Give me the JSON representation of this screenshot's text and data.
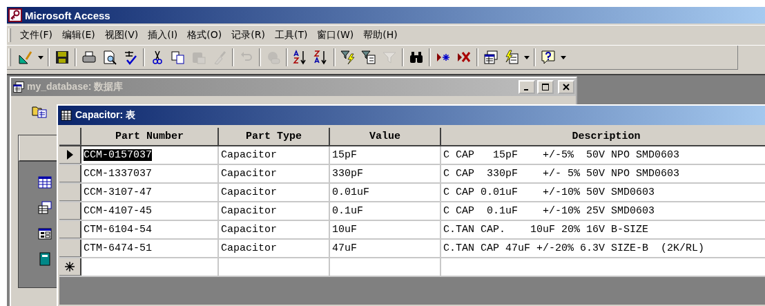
{
  "window": {
    "title": "Microsoft Access"
  },
  "menu": [
    "文件(F)",
    "编辑(E)",
    "视图(V)",
    "插入(I)",
    "格式(O)",
    "记录(R)",
    "工具(T)",
    "窗口(W)",
    "帮助(H)"
  ],
  "toolbar": [
    {
      "kind": "design",
      "disabled": false
    },
    {
      "kind": "caret",
      "disabled": false
    },
    {
      "kind": "separator"
    },
    {
      "kind": "save",
      "disabled": false
    },
    {
      "kind": "separator"
    },
    {
      "kind": "print",
      "disabled": false
    },
    {
      "kind": "preview",
      "disabled": false
    },
    {
      "kind": "spelling",
      "disabled": false
    },
    {
      "kind": "separator"
    },
    {
      "kind": "cut",
      "disabled": false
    },
    {
      "kind": "copy",
      "disabled": false
    },
    {
      "kind": "paste",
      "disabled": true
    },
    {
      "kind": "brush",
      "disabled": true
    },
    {
      "kind": "separator"
    },
    {
      "kind": "undo",
      "disabled": true
    },
    {
      "kind": "separator"
    },
    {
      "kind": "links",
      "disabled": true
    },
    {
      "kind": "separator"
    },
    {
      "kind": "sort_asc",
      "disabled": false
    },
    {
      "kind": "sort_desc",
      "disabled": false
    },
    {
      "kind": "separator"
    },
    {
      "kind": "filter_selection",
      "disabled": false
    },
    {
      "kind": "filter_form",
      "disabled": false
    },
    {
      "kind": "filter",
      "disabled": true
    },
    {
      "kind": "separator"
    },
    {
      "kind": "find",
      "disabled": false
    },
    {
      "kind": "separator"
    },
    {
      "kind": "new_record",
      "disabled": false
    },
    {
      "kind": "delete_record",
      "disabled": false
    },
    {
      "kind": "separator"
    },
    {
      "kind": "db_window",
      "disabled": false
    },
    {
      "kind": "new_object",
      "disabled": false
    },
    {
      "kind": "caret",
      "disabled": false
    },
    {
      "kind": "separator"
    },
    {
      "kind": "help",
      "disabled": false
    },
    {
      "kind": "caret",
      "disabled": false
    }
  ],
  "database_window": {
    "title": "my_database: 数据库",
    "active": false
  },
  "table_window": {
    "title": "Capacitor: 表",
    "active": true,
    "columns": [
      "Part Number",
      "Part Type",
      "Value",
      "Description"
    ],
    "rows": [
      {
        "current": true,
        "selected": true,
        "cells": [
          "CCM-0157037",
          "Capacitor",
          "15pF",
          "C CAP   15pF    +/-5%  50V NPO SMD0603"
        ]
      },
      {
        "current": false,
        "selected": false,
        "cells": [
          "CCM-1337037",
          "Capacitor",
          "330pF",
          "C CAP  330pF    +/- 5% 50V NPO SMD0603"
        ]
      },
      {
        "current": false,
        "selected": false,
        "cells": [
          "CCM-3107-47",
          "Capacitor",
          "0.01uF",
          "C CAP 0.01uF    +/-10% 50V SMD0603"
        ]
      },
      {
        "current": false,
        "selected": false,
        "cells": [
          "CCM-4107-45",
          "Capacitor",
          "0.1uF",
          "C CAP  0.1uF    +/-10% 25V SMD0603"
        ]
      },
      {
        "current": false,
        "selected": false,
        "cells": [
          "CTM-6104-54",
          "Capacitor",
          "10uF",
          "C.TAN CAP.    10uF 20% 16V B-SIZE"
        ]
      },
      {
        "current": false,
        "selected": false,
        "cells": [
          "CTM-6474-51",
          "Capacitor",
          "47uF",
          "C.TAN CAP 47uF +/-20% 6.3V SIZE-B  (2K/RL)"
        ]
      }
    ]
  }
}
